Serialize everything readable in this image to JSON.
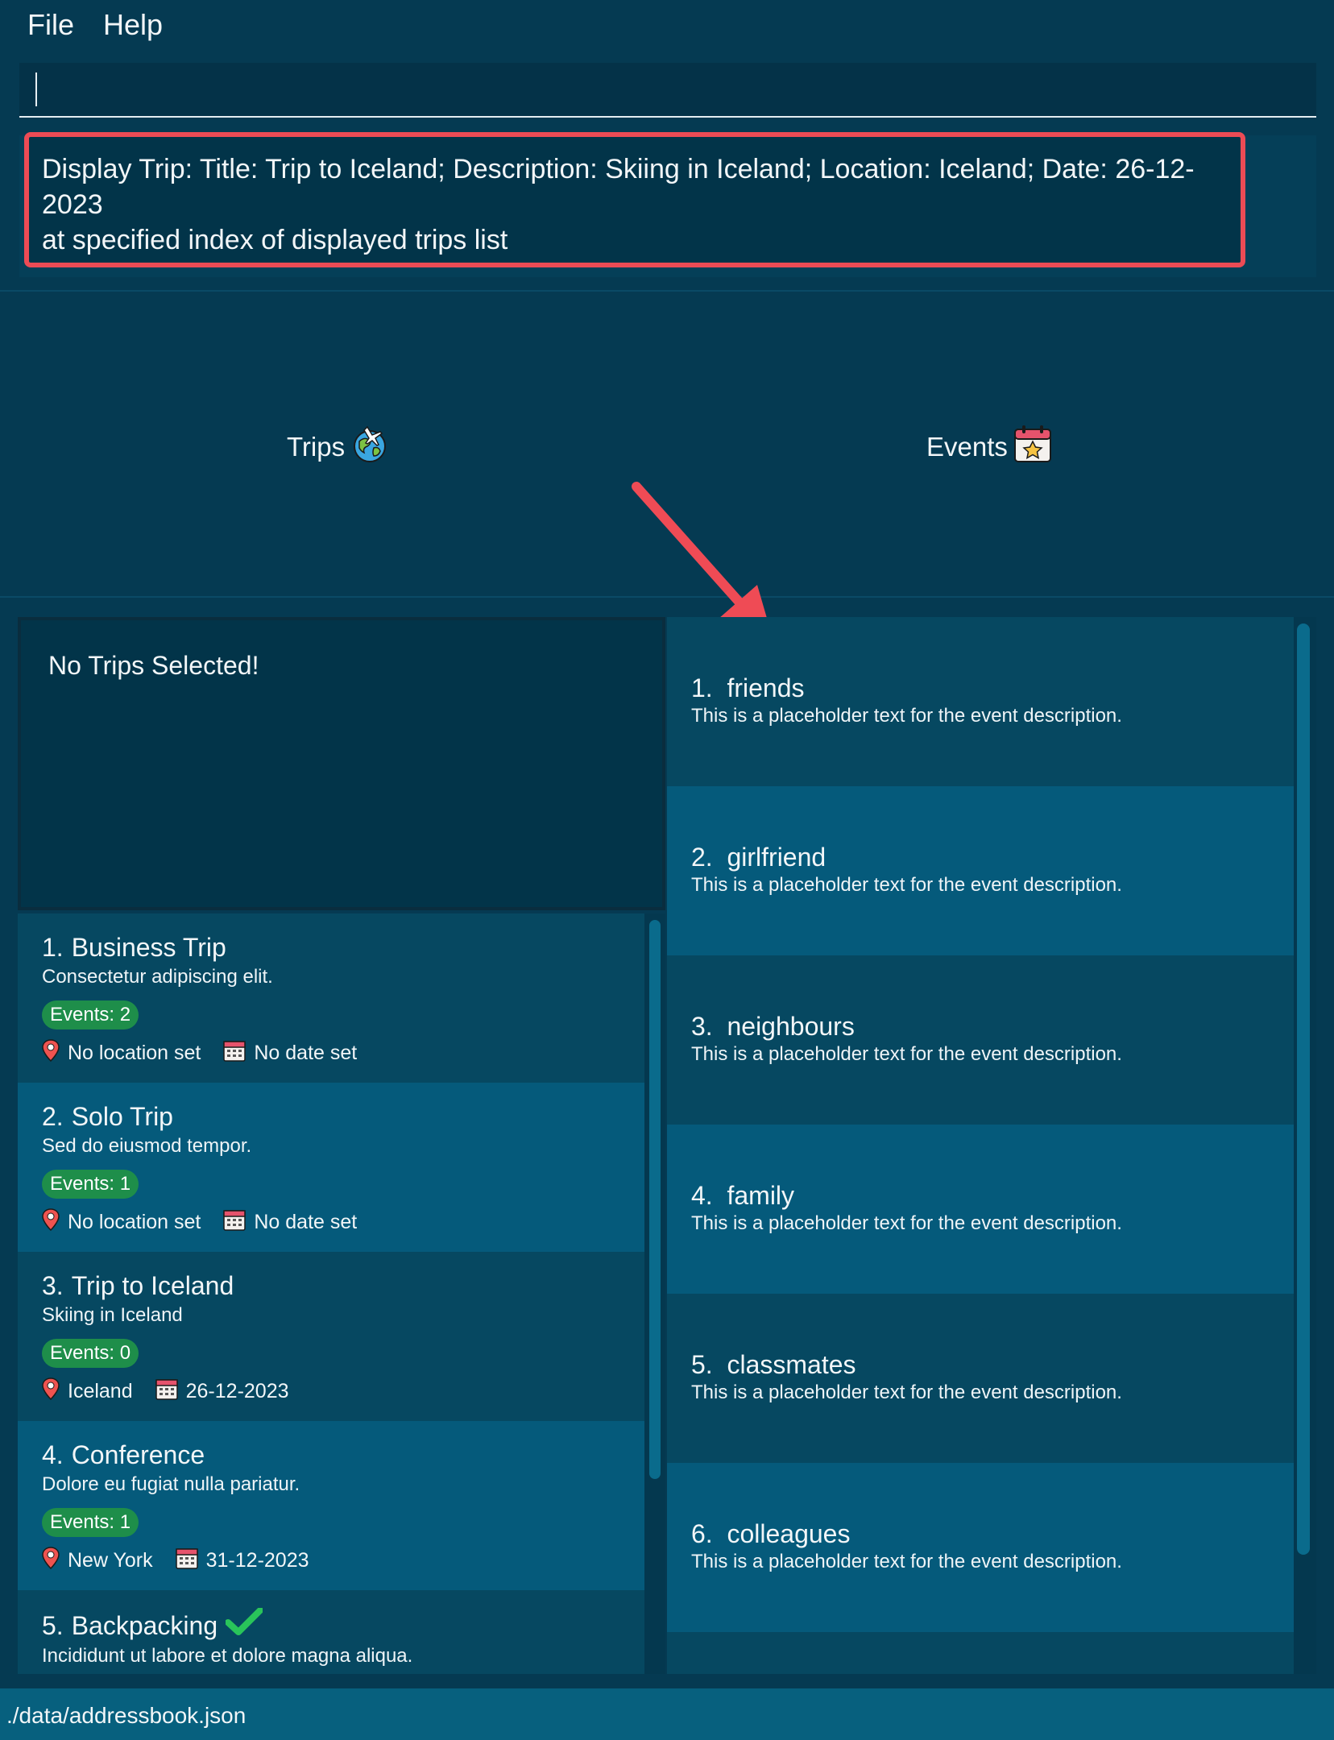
{
  "menu": {
    "file": "File",
    "help": "Help"
  },
  "command": {
    "value": "",
    "placeholder": ""
  },
  "result": {
    "line1": "Display Trip: Title: Trip to Iceland; Description: Skiing in Iceland; Location: Iceland; Date: 26-12-2023",
    "line2": "at specified index of displayed trips list"
  },
  "tabs": {
    "trips": "Trips",
    "events": "Events"
  },
  "trip_detail": {
    "empty_text": "No Trips Selected!"
  },
  "trips": [
    {
      "index": "1.",
      "title": "Business Trip",
      "description": "Consectetur adipiscing elit.",
      "events": "Events: 2",
      "location": "No location set",
      "date": "No date set"
    },
    {
      "index": "2.",
      "title": "Solo Trip",
      "description": "Sed do eiusmod tempor.",
      "events": "Events: 1",
      "location": "No location set",
      "date": "No date set"
    },
    {
      "index": "3.",
      "title": "Trip to Iceland",
      "description": "Skiing in Iceland",
      "events": "Events: 0",
      "location": "Iceland",
      "date": "26-12-2023"
    },
    {
      "index": "4.",
      "title": "Conference",
      "description": "Dolore eu fugiat nulla pariatur.",
      "events": "Events: 1",
      "location": "New York",
      "date": "31-12-2023"
    },
    {
      "index": "5.",
      "title": "Backpacking",
      "description": "Incididunt ut labore et dolore magna aliqua."
    }
  ],
  "events": [
    {
      "index": "1.",
      "title": "friends",
      "description": "This is a placeholder text for the event description."
    },
    {
      "index": "2.",
      "title": "girlfriend",
      "description": "This is a placeholder text for the event description."
    },
    {
      "index": "3.",
      "title": "neighbours",
      "description": "This is a placeholder text for the event description."
    },
    {
      "index": "4.",
      "title": "family",
      "description": "This is a placeholder text for the event description."
    },
    {
      "index": "5.",
      "title": "classmates",
      "description": "This is a placeholder text for the event description."
    },
    {
      "index": "6.",
      "title": "colleagues",
      "description": "This is a placeholder text for the event description."
    }
  ],
  "status_bar": {
    "path": "./data/addressbook.json"
  },
  "icons": {
    "trips": "globe-plane-icon",
    "events": "calendar-star-icon",
    "location": "map-pin-icon",
    "date": "calendar-icon",
    "completed": "check-icon"
  },
  "colors": {
    "background": "#053a52",
    "highlight_border": "#ec4b55",
    "arrow": "#ef4b55",
    "badge": "#1e8e4a",
    "check": "#29c45a"
  }
}
